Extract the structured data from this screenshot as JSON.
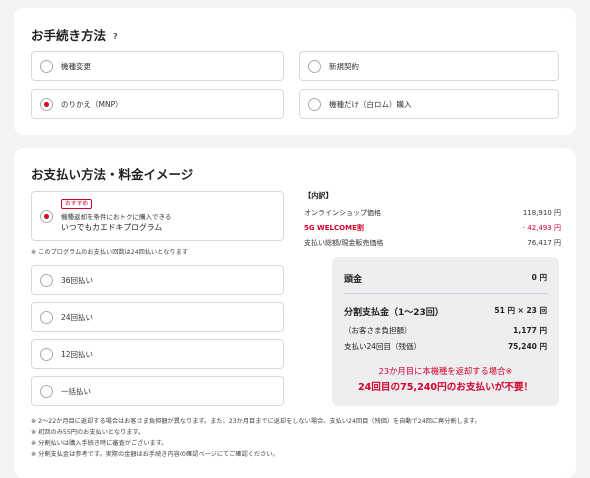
{
  "procedure": {
    "title": "お手続き方法",
    "help": "?",
    "options": [
      {
        "label": "機種変更",
        "selected": false
      },
      {
        "label": "新規契約",
        "selected": false
      },
      {
        "label": "のりかえ（MNP）",
        "selected": true
      },
      {
        "label": "機種だけ（白ロム）購入",
        "selected": false
      }
    ]
  },
  "payment": {
    "title": "お支払い方法・料金イメージ",
    "recommended": {
      "badge": "おすすめ",
      "sub": "機種返却を条件におトクに購入できる",
      "main": "いつでもカエドキプログラム",
      "selected": true
    },
    "program_note": "※ このプログラムのお支払い回数は24回払いとなります",
    "options": [
      {
        "label": "36回払い",
        "selected": false
      },
      {
        "label": "24回払い",
        "selected": false
      },
      {
        "label": "12回払い",
        "selected": false
      },
      {
        "label": "一括払い",
        "selected": false
      }
    ],
    "footnotes": [
      "※ 2～22か月目に返却する場合はお客さま負担額が異なります。また、23か月目までに返却をしない場合、支払い24回目（残価）を自動で24回に再分割します。",
      "※ 初回のみ55円のお支払いとなります。",
      "※ 分割払いは購入手続き時に審査がございます。",
      "※ 分割支払金は参考です。実際の金額はお手続き内容の確認ページにてご確認ください。"
    ]
  },
  "breakdown": {
    "title": "【内訳】",
    "rows": [
      {
        "label": "オンラインショップ価格",
        "value": "118,910 円",
        "highlight": false
      },
      {
        "label": "5G WELCOME割",
        "value": "- 42,493 円",
        "highlight": true
      },
      {
        "label": "支払い総額/現金販売価格",
        "value": "76,417 円",
        "highlight": false
      }
    ]
  },
  "summary": {
    "down_payment_label": "頭金",
    "down_payment_value": "0 円",
    "installment_label": "分割支払金（1～23回）",
    "installment_value": "51 円 × 23 回",
    "customer_label": "（お客さま負担額）",
    "customer_value": "1,177 円",
    "final_label": "支払い24回目（残価）",
    "final_value": "75,240 円",
    "warning_line1": "23か月目に本機種を返却する場合※",
    "warning_line2": "24回目の75,240円のお支払いが不要！",
    "accent_color": "#d1002b"
  }
}
